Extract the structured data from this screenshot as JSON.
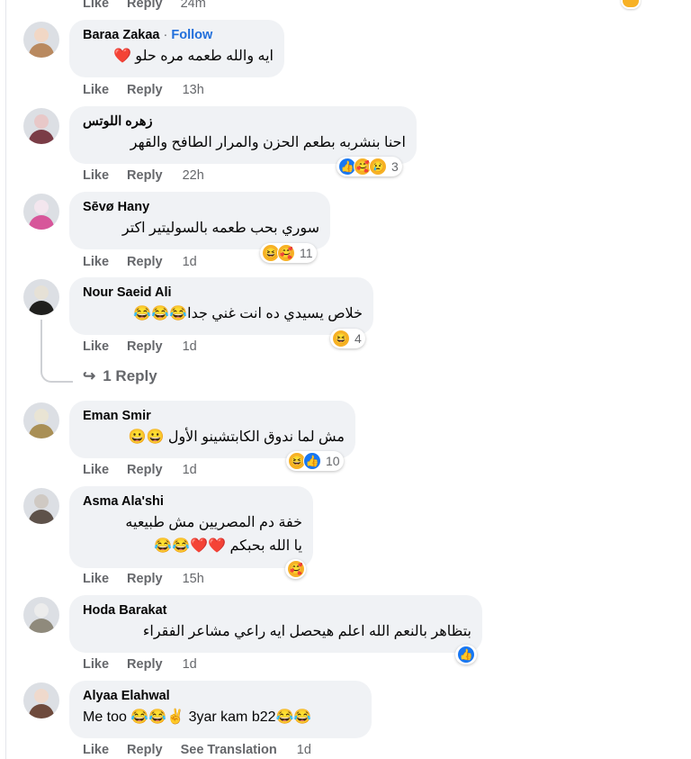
{
  "top": {
    "like": "Like",
    "reply": "Reply",
    "time": "24m"
  },
  "comments": [
    {
      "name": "Baraa Zakaa",
      "follow": "Follow",
      "text": "ايه والله طعمه مره حلو ❤️",
      "like": "Like",
      "reply": "Reply",
      "time": "13h",
      "avatar": [
        "#f1d7c5",
        "#b9895f"
      ]
    },
    {
      "name": "زهره اللوتس",
      "text": "احنا بنشربه بطعم الحزن والمرار الطافح والقهر",
      "like": "Like",
      "reply": "Reply",
      "time": "22h",
      "reactions": [
        "like",
        "care",
        "sad"
      ],
      "count": "3",
      "avatar": [
        "#e8c8c8",
        "#7a3c46"
      ]
    },
    {
      "name": "Sēvø Hany",
      "text": "سوري بحب طعمه بالسوليتير اكتر",
      "like": "Like",
      "reply": "Reply",
      "time": "1d",
      "reactions": [
        "haha",
        "care"
      ],
      "count": "11",
      "avatar": [
        "#f3e6ee",
        "#d7569a"
      ]
    },
    {
      "name": "Nour Saeid Ali",
      "text": "خلاص يسيدي ده انت غني جدا😂😂😂",
      "like": "Like",
      "reply": "Reply",
      "time": "1d",
      "reactions": [
        "haha"
      ],
      "count": "4",
      "replies": "1 Reply",
      "avatar": [
        "#e6e1d6",
        "#20201e"
      ]
    },
    {
      "name": "Eman Smir",
      "text": "مش لما ندوق الكابتشينو الأول 😀😀",
      "like": "Like",
      "reply": "Reply",
      "time": "1d",
      "reactions": [
        "haha",
        "like"
      ],
      "count": "10",
      "avatar": [
        "#e9e4d4",
        "#a98f55"
      ]
    },
    {
      "name": "Asma Ala'shi",
      "text": "خفة دم المصريين مش طبيعيه",
      "text2": "يا الله بحبكم ❤️❤️😂😂",
      "like": "Like",
      "reply": "Reply",
      "time": "15h",
      "reactions": [
        "care"
      ],
      "avatar": [
        "#cfc9c3",
        "#5e524a"
      ]
    },
    {
      "name": "Hoda Barakat",
      "text": "بتظاهر بالنعم الله اعلم هيحصل ايه راعي مشاعر الفقراء",
      "like": "Like",
      "reply": "Reply",
      "time": "1d",
      "reactions": [
        "like"
      ],
      "avatar": [
        "#ececec",
        "#8f8a7c"
      ]
    },
    {
      "name": "Alyaa Elahwal",
      "text": "Me too 😂😂✌️ 3yar kam b22😂😂",
      "like": "Like",
      "reply": "Reply",
      "see_translation": "See Translation",
      "time": "1d",
      "avatar": [
        "#efd9cc",
        "#6e4a3c"
      ]
    }
  ],
  "icons": {
    "like": "👍",
    "haha": "😆",
    "care": "🥰",
    "sad": "😢",
    "love": "❤"
  },
  "colors": {
    "like": "#1877f2",
    "emoji": "#f7b125",
    "follow": "#216fdb",
    "bubble": "#f0f2f5",
    "meta": "#65676b"
  }
}
